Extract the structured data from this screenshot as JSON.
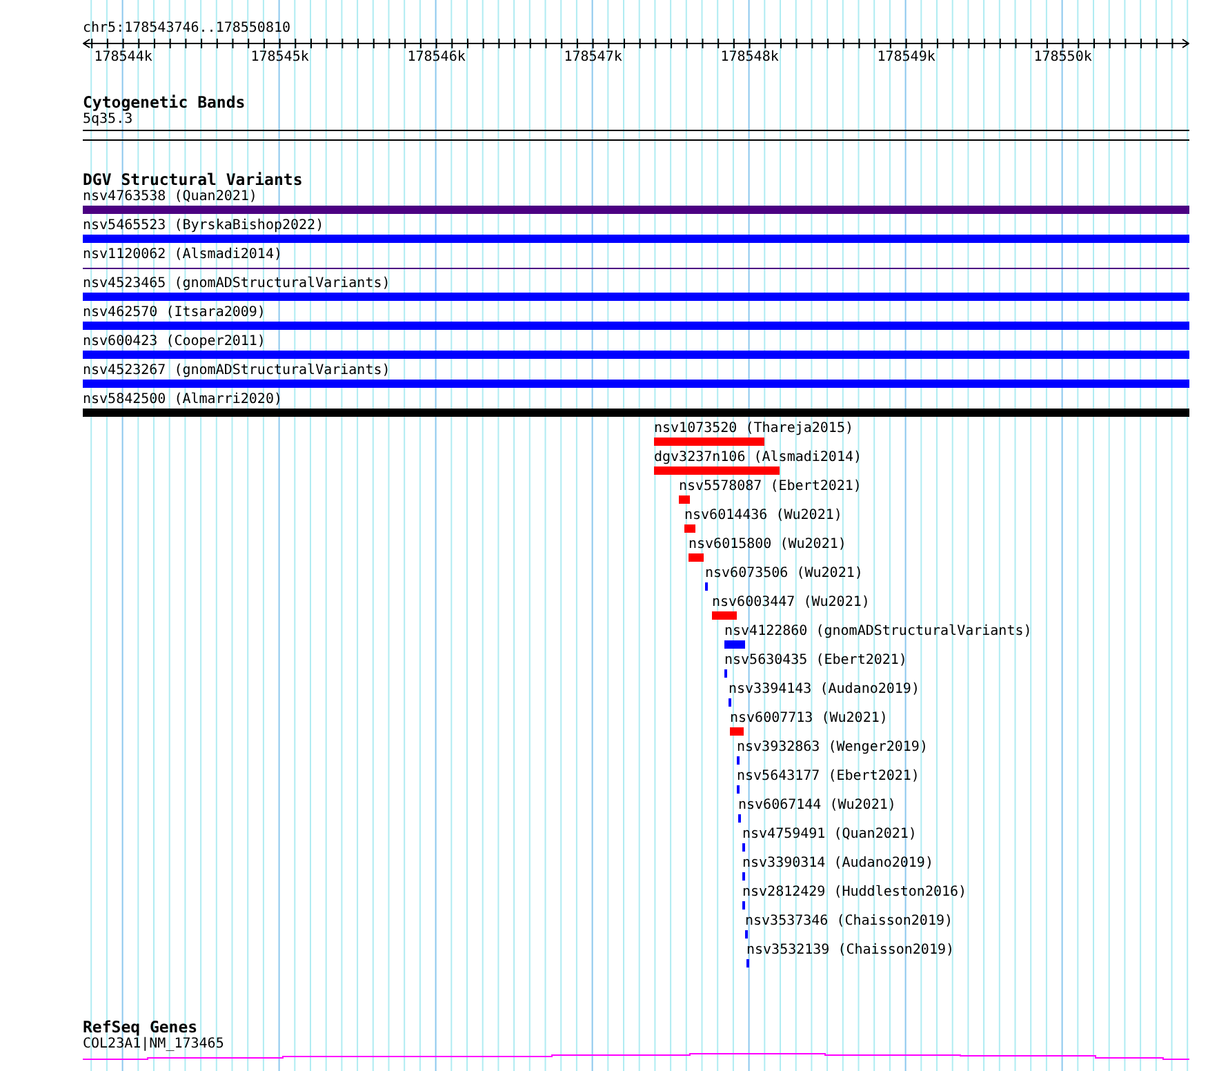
{
  "ruler": {
    "location": "chr5:178543746..178550810",
    "ticks": [
      "178544k",
      "178545k",
      "178546k",
      "178547k",
      "178548k",
      "178549k",
      "178550k"
    ]
  },
  "tracks": [
    {
      "title": "Cytogenetic Bands",
      "kind": "bands",
      "features": [
        {
          "label": "5q35.3"
        }
      ]
    },
    {
      "title": "DGV Structural Variants",
      "kind": "variants",
      "features": [
        {
          "label": "nsv4763538 (Quan2021)",
          "color": "#4b0082",
          "kind": "bar"
        },
        {
          "label": "nsv5465523 (ByrskaBishop2022)",
          "color": "#0000ff",
          "kind": "bar"
        },
        {
          "label": "nsv1120062 (Alsmadi2014)",
          "color": "#4b0082",
          "kind": "line"
        },
        {
          "label": "nsv4523465 (gnomADStructuralVariants)",
          "color": "#0000ff",
          "kind": "bar"
        },
        {
          "label": "nsv462570 (Itsara2009)",
          "color": "#0000ff",
          "kind": "bar"
        },
        {
          "label": "nsv600423 (Cooper2011)",
          "color": "#0000ff",
          "kind": "bar"
        },
        {
          "label": "nsv4523267 (gnomADStructuralVariants)",
          "color": "#0000ff",
          "kind": "bar"
        },
        {
          "label": "nsv5842500 (Almarri2020)",
          "color": "#000000",
          "kind": "bar"
        },
        {
          "label": "nsv1073520 (Thareja2015)",
          "color": "#ff0000",
          "kind": "bar"
        },
        {
          "label": "dgv3237n106 (Alsmadi2014)",
          "color": "#ff0000",
          "kind": "bar"
        },
        {
          "label": "nsv5578087 (Ebert2021)",
          "color": "#ff0000",
          "kind": "bar"
        },
        {
          "label": "nsv6014436 (Wu2021)",
          "color": "#ff0000",
          "kind": "bar"
        },
        {
          "label": "nsv6015800 (Wu2021)",
          "color": "#ff0000",
          "kind": "bar"
        },
        {
          "label": "nsv6073506 (Wu2021)",
          "color": "#0000ff",
          "kind": "bar"
        },
        {
          "label": "nsv6003447 (Wu2021)",
          "color": "#ff0000",
          "kind": "bar"
        },
        {
          "label": "nsv4122860 (gnomADStructuralVariants)",
          "color": "#0000ff",
          "kind": "bar"
        },
        {
          "label": "nsv5630435 (Ebert2021)",
          "color": "#0000ff",
          "kind": "bar"
        },
        {
          "label": "nsv3394143 (Audano2019)",
          "color": "#0000ff",
          "kind": "bar"
        },
        {
          "label": "nsv6007713 (Wu2021)",
          "color": "#ff0000",
          "kind": "bar"
        },
        {
          "label": "nsv3932863 (Wenger2019)",
          "color": "#0000ff",
          "kind": "bar"
        },
        {
          "label": "nsv5643177 (Ebert2021)",
          "color": "#0000ff",
          "kind": "bar"
        },
        {
          "label": "nsv6067144 (Wu2021)",
          "color": "#0000ff",
          "kind": "bar"
        },
        {
          "label": "nsv4759491 (Quan2021)",
          "color": "#0000ff",
          "kind": "bar"
        },
        {
          "label": "nsv3390314 (Audano2019)",
          "color": "#0000ff",
          "kind": "bar"
        },
        {
          "label": "nsv2812429 (Huddleston2016)",
          "color": "#0000ff",
          "kind": "bar"
        },
        {
          "label": "nsv3537346 (Chaisson2019)",
          "color": "#0000ff",
          "kind": "bar"
        },
        {
          "label": "nsv3532139 (Chaisson2019)",
          "color": "#0000ff",
          "kind": "bar"
        }
      ]
    },
    {
      "title": "RefSeq Genes",
      "kind": "genes",
      "features": [
        {
          "label": "COL23A1|NM_173465"
        }
      ]
    }
  ]
}
